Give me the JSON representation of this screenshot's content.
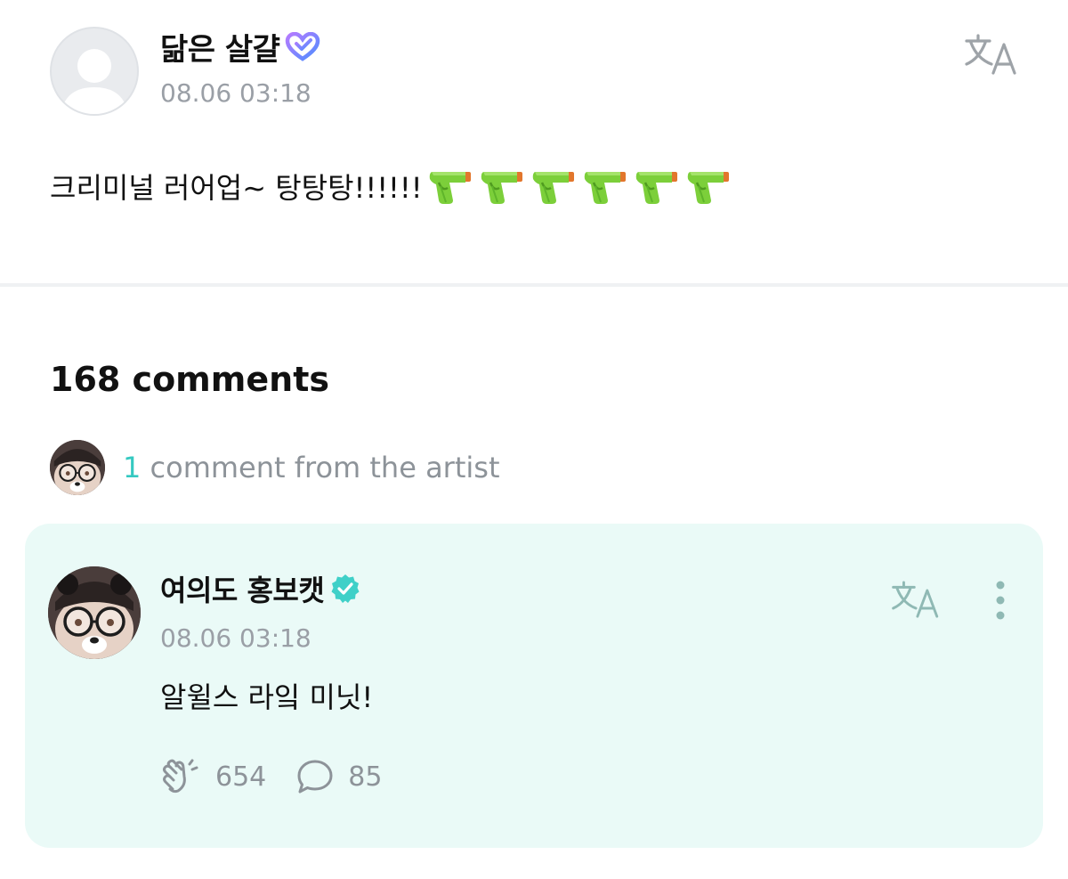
{
  "post": {
    "author": "닮은 살걀",
    "timestamp": "08.06 03:18",
    "body_text": "크리미널 러어업~ 탕탕탕!!!!!!",
    "gun_emoji_count": 6,
    "icons": {
      "badge": "membership-heart-icon",
      "translate": "translate-icon",
      "emoji": "water-pistol-emoji"
    }
  },
  "comments": {
    "count_label": "168 comments",
    "artist_summary": {
      "count": "1",
      "label": "comment from the artist"
    },
    "items": [
      {
        "author": "여의도 홍보캣",
        "timestamp": "08.06 03:18",
        "text": "알윌스 라잌 미닛!",
        "likes": "654",
        "replies": "85",
        "icons": {
          "verified": "verified-badge-icon",
          "translate": "translate-icon",
          "more": "more-vertical-icon",
          "like": "clap-like-icon",
          "reply": "speech-bubble-icon"
        }
      }
    ]
  },
  "colors": {
    "accent": "#35c9c1",
    "comment_card_bg": "#eafaf7",
    "muted_text": "#9a9fa6",
    "divider": "#eff1f3"
  }
}
